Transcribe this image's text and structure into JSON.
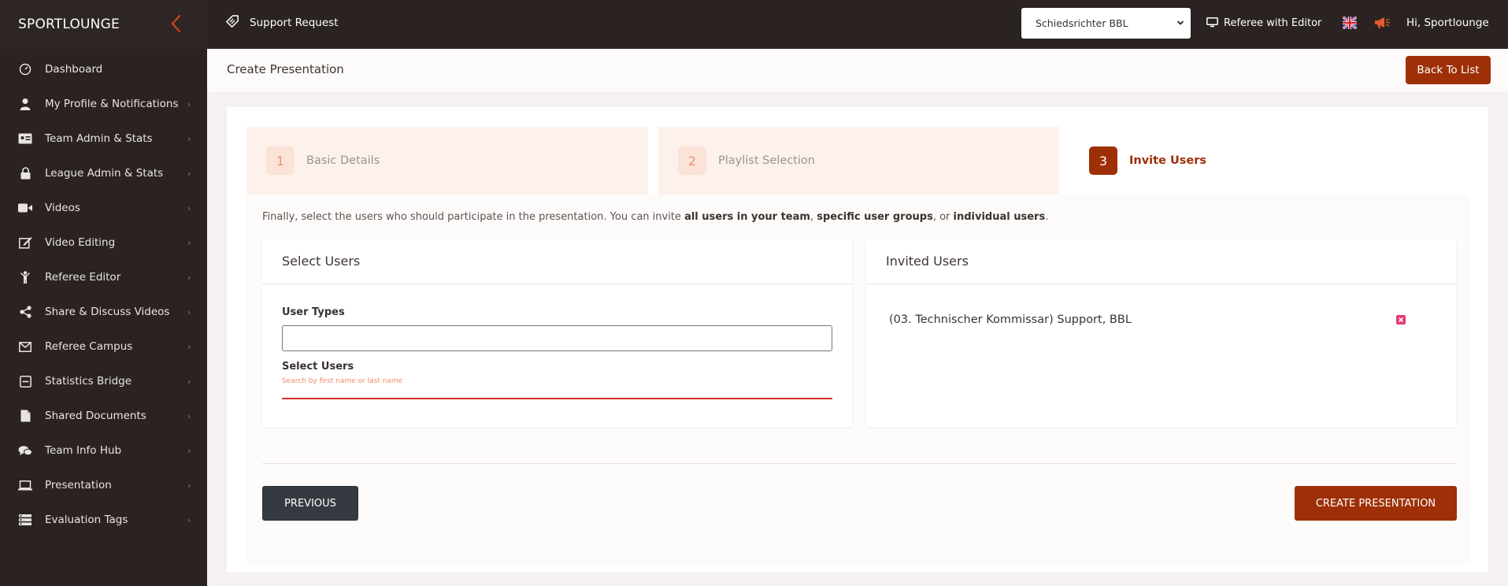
{
  "brand": "SPORTLOUNGE",
  "sidebar": {
    "items": [
      {
        "label": "Dashboard",
        "icon": "dashboard-gauge-icon"
      },
      {
        "label": "My Profile & Notifications",
        "icon": "user-icon"
      },
      {
        "label": "Team Admin & Stats",
        "icon": "id-card-icon"
      },
      {
        "label": "League Admin & Stats",
        "icon": "lock-icon"
      },
      {
        "label": "Videos",
        "icon": "video-camera-icon"
      },
      {
        "label": "Video Editing",
        "icon": "edit-icon"
      },
      {
        "label": "Referee Editor",
        "icon": "referee-icon"
      },
      {
        "label": "Share & Discuss Videos",
        "icon": "share-icon"
      },
      {
        "label": "Referee Campus",
        "icon": "mail-icon"
      },
      {
        "label": "Statistics Bridge",
        "icon": "box-minus-icon"
      },
      {
        "label": "Shared Documents",
        "icon": "document-icon"
      },
      {
        "label": "Team Info Hub",
        "icon": "chat-icon"
      },
      {
        "label": "Presentation",
        "icon": "laptop-icon"
      },
      {
        "label": "Evaluation Tags",
        "icon": "tags-icon"
      }
    ]
  },
  "topbar": {
    "title": "Support Request",
    "select_value": "Schiedsrichter BBL",
    "mode": "Referee with Editor",
    "greeting": "Hi,  Sportlounge"
  },
  "page": {
    "title": "Create Presentation",
    "back_button": "Back To List"
  },
  "steps": [
    {
      "number": "1",
      "label": "Basic Details",
      "active": false
    },
    {
      "number": "2",
      "label": "Playlist Selection",
      "active": false
    },
    {
      "number": "3",
      "label": "Invite Users",
      "active": true
    }
  ],
  "intro": {
    "part1": "Finally, select the users who should participate in the presentation. You can invite ",
    "b1": "all users in your team",
    "sep1": ", ",
    "b2": "specific user groups",
    "sep2": ", or ",
    "b3": "individual users",
    "end": "."
  },
  "select_users": {
    "title": "Select Users",
    "user_types_label": "User Types",
    "user_types_value": "",
    "select_users_label": "Select Users",
    "search_placeholder": "Search by first name or last name"
  },
  "invited_users": {
    "title": "Invited Users",
    "users": [
      "(03. Technischer Kommissar) Support, BBL"
    ]
  },
  "actions": {
    "previous": "PREVIOUS",
    "create": "CREATE PRESENTATION"
  },
  "colors": {
    "accent": "#9e2f06",
    "sidebar_bg": "#2a2322",
    "step_inactive_bg": "#fdf1ec",
    "remove": "#e8386e",
    "error_underline": "#d93025"
  }
}
